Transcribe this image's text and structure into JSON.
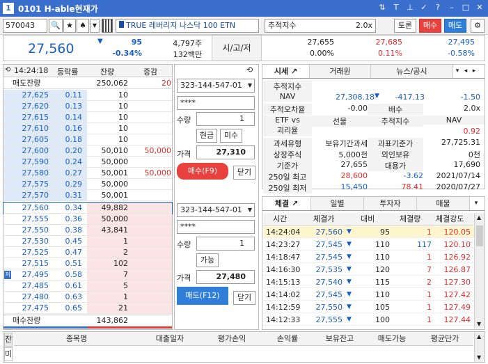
{
  "window": {
    "number": "1",
    "title": "0101 H-able현재가"
  },
  "toolbar": {
    "code": "570043",
    "name": "TRUE 레버리지 나스닥 100 ETN",
    "tracking_label": "추적지수",
    "tracking_value": "2.0x",
    "discussion": "토론",
    "buy": "매수",
    "sell": "매도"
  },
  "summary": {
    "price": "27,560",
    "change": "95",
    "change_pct": "-0.34%",
    "volume": "4,797주",
    "amount": "132백만",
    "ohl_label": "시/고/저",
    "open": "27,655",
    "high": "27,685",
    "low": "27,495",
    "open_pct": "0.00%",
    "high_pct": "0.11%",
    "low_pct": "-0.58%"
  },
  "orderbook": {
    "time": "14:24:18",
    "headers": [
      "등락률",
      "잔량",
      "증감"
    ],
    "sell_total_label": "매도잔량",
    "sell_total": "250,062",
    "sell_change": "20",
    "buy_total_label": "매수잔량",
    "buy_total": "143,862",
    "asks": [
      {
        "price": "27,625",
        "rate": "0.11",
        "qty": "10",
        "chg": ""
      },
      {
        "price": "27,620",
        "rate": "0.13",
        "qty": "10",
        "chg": ""
      },
      {
        "price": "27,615",
        "rate": "0.14",
        "qty": "10",
        "chg": ""
      },
      {
        "price": "27,610",
        "rate": "0.16",
        "qty": "10",
        "chg": ""
      },
      {
        "price": "27,605",
        "rate": "0.18",
        "qty": "10",
        "chg": ""
      },
      {
        "price": "27,600",
        "rate": "0.20",
        "qty": "50,010",
        "chg": "50,000"
      },
      {
        "price": "27,590",
        "rate": "0.24",
        "qty": "50,000",
        "chg": ""
      },
      {
        "price": "27,580",
        "rate": "0.27",
        "qty": "50,001",
        "chg": "50,000"
      },
      {
        "price": "27,575",
        "rate": "0.29",
        "qty": "50,000",
        "chg": ""
      },
      {
        "price": "27,570",
        "rate": "0.31",
        "qty": "50,001",
        "chg": ""
      }
    ],
    "bids": [
      {
        "price": "27,560",
        "rate": "0.34",
        "qty": "49,882",
        "chg": ""
      },
      {
        "price": "27,555",
        "rate": "0.36",
        "qty": "50,000",
        "chg": ""
      },
      {
        "price": "27,550",
        "rate": "0.38",
        "qty": "43,841",
        "chg": ""
      },
      {
        "price": "27,530",
        "rate": "0.45",
        "qty": "1",
        "chg": ""
      },
      {
        "price": "27,525",
        "rate": "0.47",
        "qty": "2",
        "chg": ""
      },
      {
        "price": "27,515",
        "rate": "0.51",
        "qty": "102",
        "chg": ""
      },
      {
        "price": "27,495",
        "rate": "0.58",
        "qty": "7",
        "chg": ""
      },
      {
        "price": "27,485",
        "rate": "0.61",
        "qty": "5",
        "chg": ""
      },
      {
        "price": "27,480",
        "rate": "0.63",
        "qty": "1",
        "chg": ""
      },
      {
        "price": "27,475",
        "rate": "0.65",
        "qty": "21",
        "chg": ""
      }
    ],
    "low_marker": "저"
  },
  "buy_order": {
    "account": "323-144-547-01",
    "password": "****",
    "qty_label": "수량",
    "qty": "1",
    "cash": "현금",
    "unfilled": "미수",
    "price_label": "가격",
    "price": "27,310",
    "submit": "매수(F9)",
    "close": "닫기"
  },
  "sell_order": {
    "account": "323-144-547-01",
    "password": "****",
    "qty_label": "수량",
    "qty": "1",
    "available": "가능",
    "price_label": "가격",
    "price": "27,480",
    "submit": "매도(F12)",
    "close": "닫기"
  },
  "info_tabs": [
    "시세",
    "거래원",
    "뉴스/공시"
  ],
  "info": {
    "track_label": "추적지수",
    "nav_label": "NAV",
    "nav": "27,308.18",
    "nav_diff": "-417.13",
    "nav_pct": "-1.50",
    "err_label": "추적오차율",
    "err": "-0.00",
    "mult_label": "배수",
    "mult": "2.0x",
    "etf_label": "ETF vs",
    "col_futures": "선물",
    "col_track": "추적지수",
    "col_nav": "NAV",
    "gap_label": "괴리율",
    "gap_nav": "0.92",
    "tax_label": "과세유형",
    "tax": "보유기간과세",
    "base_label": "과표기준가",
    "base": "27,725.31",
    "listed_label": "상장주식",
    "listed": "5,000천",
    "foreign_label": "외인보유",
    "foreign": "0천",
    "std_label": "기준가",
    "std": "27,655",
    "sub_label": "대용가",
    "sub": "17,690",
    "hi250_label": "250일 최고",
    "hi250": "28,600",
    "hi250_diff": "-3.62",
    "hi250_date": "2021/07/14",
    "lo250_label": "250일 최저",
    "lo250": "15,450",
    "lo250_diff": "78.41",
    "lo250_date": "2020/07/27"
  },
  "trade_tabs": [
    "체결",
    "일별",
    "투자자",
    "매물"
  ],
  "trade_headers": [
    "시간",
    "체결가",
    "대비",
    "체결량",
    "체결강도"
  ],
  "trades": [
    {
      "time": "14:24:04",
      "price": "27,560",
      "diff": "95",
      "vol": "1",
      "strength": "120.05"
    },
    {
      "time": "14:23:27",
      "price": "27,545",
      "diff": "110",
      "vol": "117",
      "strength": "120.10"
    },
    {
      "time": "14:18:47",
      "price": "27,545",
      "diff": "110",
      "vol": "1",
      "strength": "126.92"
    },
    {
      "time": "14:16:30",
      "price": "27,535",
      "diff": "120",
      "vol": "7",
      "strength": "126.87"
    },
    {
      "time": "14:15:13",
      "price": "27,540",
      "diff": "115",
      "vol": "2",
      "strength": "127.30"
    },
    {
      "time": "14:14:02",
      "price": "27,545",
      "diff": "110",
      "vol": "1",
      "strength": "127.42"
    },
    {
      "time": "14:12:59",
      "price": "27,550",
      "diff": "105",
      "vol": "1",
      "strength": "127.49"
    },
    {
      "time": "14:12:33",
      "price": "27,555",
      "diff": "100",
      "vol": "1",
      "strength": "127.44"
    }
  ],
  "bottom": {
    "side_labels": [
      "잔",
      "미"
    ],
    "headers": [
      "종목명",
      "대출일자",
      "평가손익",
      "손익률",
      "보유잔고",
      "매도가능",
      "평균단가"
    ]
  }
}
